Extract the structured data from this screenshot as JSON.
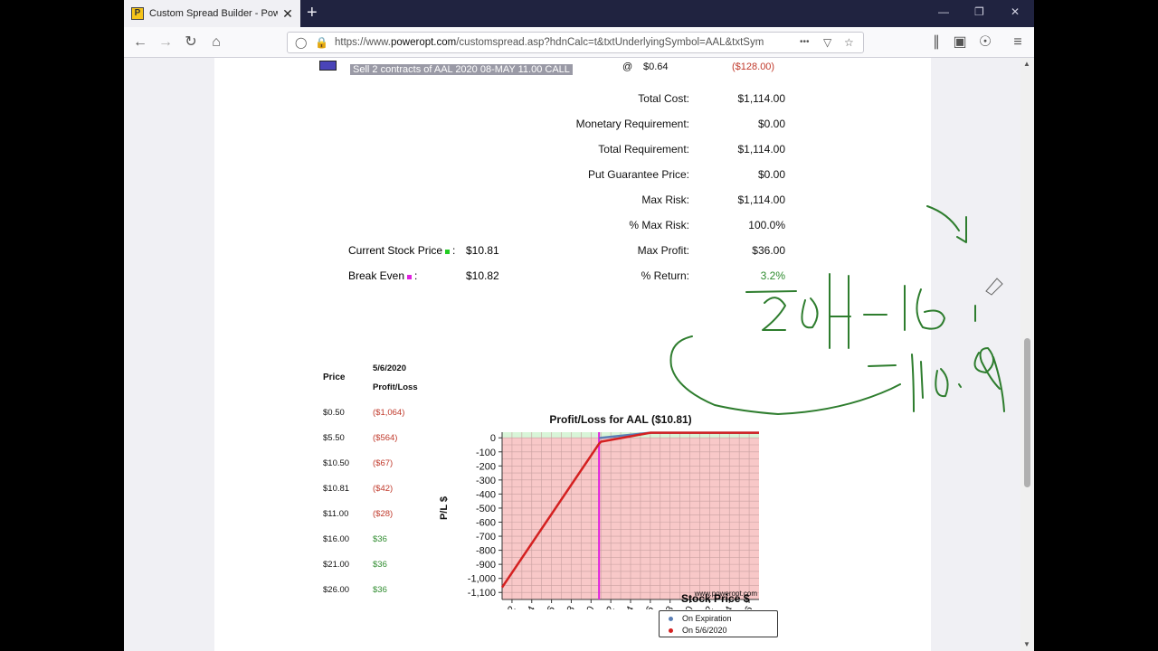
{
  "browser": {
    "tab_title": "Custom Spread Builder - PowerOpt",
    "tab_icon_glyph": "P",
    "url_prefix": "https://www.",
    "url_domain": "poweropt.com",
    "url_rest": "/customspread.asp?hdnCalc=t&txtUnderlyingSymbol=AAL&txtSym",
    "url_more": "•••",
    "new_tab": "+",
    "close": "✕",
    "win_min": "—",
    "win_max": "❐",
    "win_close": "✕"
  },
  "order": {
    "leg_text": "Sell 2 contracts of AAL 2020 08-MAY 11.00 CALL",
    "at": "@",
    "price": "$0.64",
    "amount": "($128.00)"
  },
  "summary": [
    {
      "label": "Total Cost:",
      "value": "$1,114.00"
    },
    {
      "label": "Monetary Requirement:",
      "value": "$0.00"
    },
    {
      "label": "Total Requirement:",
      "value": "$1,114.00"
    },
    {
      "label": "Put Guarantee Price:",
      "value": "$0.00"
    },
    {
      "label": "Max Risk:",
      "value": "$1,114.00"
    },
    {
      "label": "% Max Risk:",
      "value": "100.0%"
    },
    {
      "label": "Max Profit:",
      "value": "$36.00"
    },
    {
      "label": "% Return:",
      "value": "3.2%"
    }
  ],
  "stock": {
    "current_label": "Current Stock Price",
    "current_value": "$10.81",
    "breakeven_label": "Break Even",
    "breakeven_value": "$10.82",
    "colon": ":"
  },
  "pl_table": {
    "price_header": "Price",
    "date_header": "5/6/2020",
    "pl_header": "Profit/Loss",
    "rows": [
      {
        "price": "$0.50",
        "pl": "($1,064)",
        "sign": "neg"
      },
      {
        "price": "$5.50",
        "pl": "($564)",
        "sign": "neg"
      },
      {
        "price": "$10.50",
        "pl": "($67)",
        "sign": "neg"
      },
      {
        "price": "$10.81",
        "pl": "($42)",
        "sign": "neg"
      },
      {
        "price": "$11.00",
        "pl": "($28)",
        "sign": "neg"
      },
      {
        "price": "$16.00",
        "pl": "$36",
        "sign": "pos"
      },
      {
        "price": "$21.00",
        "pl": "$36",
        "sign": "pos"
      },
      {
        "price": "$26.00",
        "pl": "$36",
        "sign": "pos"
      }
    ]
  },
  "chart_data": {
    "type": "line",
    "title": "Profit/Loss for AAL ($10.81)",
    "xlabel": "Stock Price $",
    "ylabel": "P/L $",
    "xlim": [
      1,
      27
    ],
    "ylim": [
      -1150,
      40
    ],
    "x_ticks": [
      2,
      4,
      6,
      8,
      10,
      12,
      14,
      16,
      18,
      20,
      22,
      24,
      26
    ],
    "y_ticks": [
      0,
      -100,
      -200,
      -300,
      -400,
      -500,
      -600,
      -700,
      -800,
      -900,
      -1000,
      -1100
    ],
    "y_tick_labels": [
      "0",
      "-100",
      "-200",
      "-300",
      "-400",
      "-500",
      "-600",
      "-700",
      "-800",
      "-900",
      "-1,000",
      "-1,100"
    ],
    "watermark": "www.poweropt.com",
    "current_price": 10.81,
    "grid": true,
    "legend_position": "bottom",
    "series": [
      {
        "name": "On Expiration",
        "color": "#5b7fb5",
        "x": [
          10.81,
          11,
          16,
          27
        ],
        "y": [
          -1,
          0,
          36,
          36
        ]
      },
      {
        "name": "On 5/6/2020",
        "color": "#d42020",
        "x": [
          1,
          10.81,
          11,
          16,
          21,
          26,
          27
        ],
        "y": [
          -1064,
          -42,
          -28,
          36,
          36,
          36,
          36
        ]
      }
    ]
  },
  "colors": {
    "loss_fill": "#f8c8c8",
    "profit_fill": "#d8f5d8",
    "current_line": "#e020e0",
    "annotation_ink": "#2e7d2e"
  }
}
